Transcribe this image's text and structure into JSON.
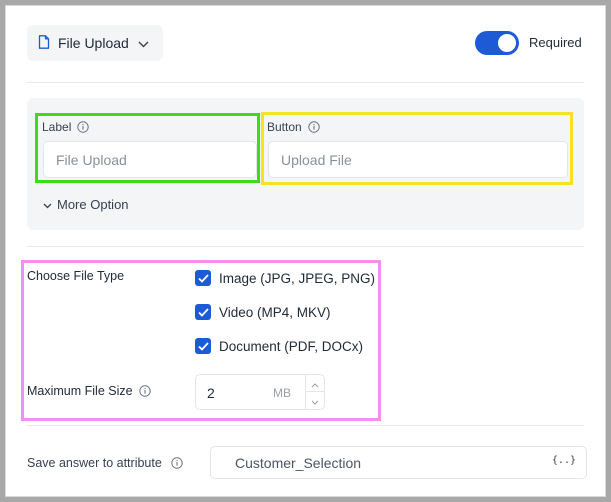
{
  "field_type": {
    "label": "File Upload",
    "icon": "file-icon"
  },
  "required": {
    "label": "Required",
    "enabled": true
  },
  "label_field": {
    "label": "Label",
    "placeholder": "File Upload"
  },
  "button_field": {
    "label": "Button",
    "placeholder": "Upload File"
  },
  "more_options": {
    "label": "More Option"
  },
  "file_types": {
    "label": "Choose File Type",
    "options": [
      {
        "label": "Image (JPG, JPEG, PNG)",
        "checked": true
      },
      {
        "label": "Video (MP4, MKV)",
        "checked": true
      },
      {
        "label": "Document (PDF, DOCx)",
        "checked": true
      }
    ]
  },
  "max_size": {
    "label": "Maximum File Size",
    "value": "2",
    "unit": "MB"
  },
  "save_attribute": {
    "label": "Save answer to attribute",
    "value": "Customer_Selection",
    "icon_text": "{..}"
  },
  "colors": {
    "accent": "#1d5bd6",
    "highlight_green": "#3ddc1a",
    "highlight_yellow": "#f7e123",
    "highlight_pink": "#f58ef0"
  }
}
